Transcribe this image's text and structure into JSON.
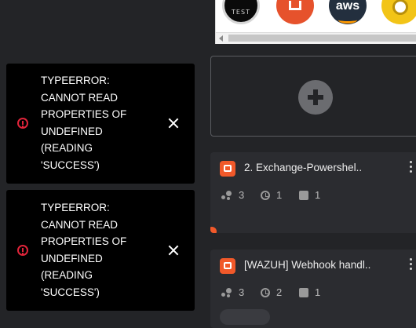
{
  "app_strip": {
    "apps": [
      {
        "icon": "test-app-icon",
        "label": "TEST"
      },
      {
        "icon": "red-integration-icon",
        "label": ""
      },
      {
        "icon": "aws-icon",
        "label": "aws"
      },
      {
        "icon": "yellow-integration-icon",
        "label": ""
      }
    ]
  },
  "toasts": [
    {
      "message": "TYPEERROR:\nCANNOT READ\nPROPERTIES OF\nUNDEFINED\n(READING\n'SUCCESS')",
      "icon": "error-icon",
      "close_icon": "close-icon",
      "color": "#e0243a"
    },
    {
      "message": "TYPEERROR:\nCANNOT READ\nPROPERTIES OF\nUNDEFINED\n(READING\n'SUCCESS')",
      "icon": "error-icon",
      "close_icon": "close-icon",
      "color": "#e0243a"
    }
  ],
  "workflows": [
    {
      "title": "2. Exchange-Powershel..",
      "nodes": "3",
      "executions": "1",
      "apps": "1"
    },
    {
      "title": "[WAZUH] Webhook handl..",
      "nodes": "3",
      "executions": "2",
      "apps": "1"
    }
  ],
  "colors": {
    "accent": "#f1592a",
    "background": "#232427",
    "card": "#2b2c30"
  }
}
